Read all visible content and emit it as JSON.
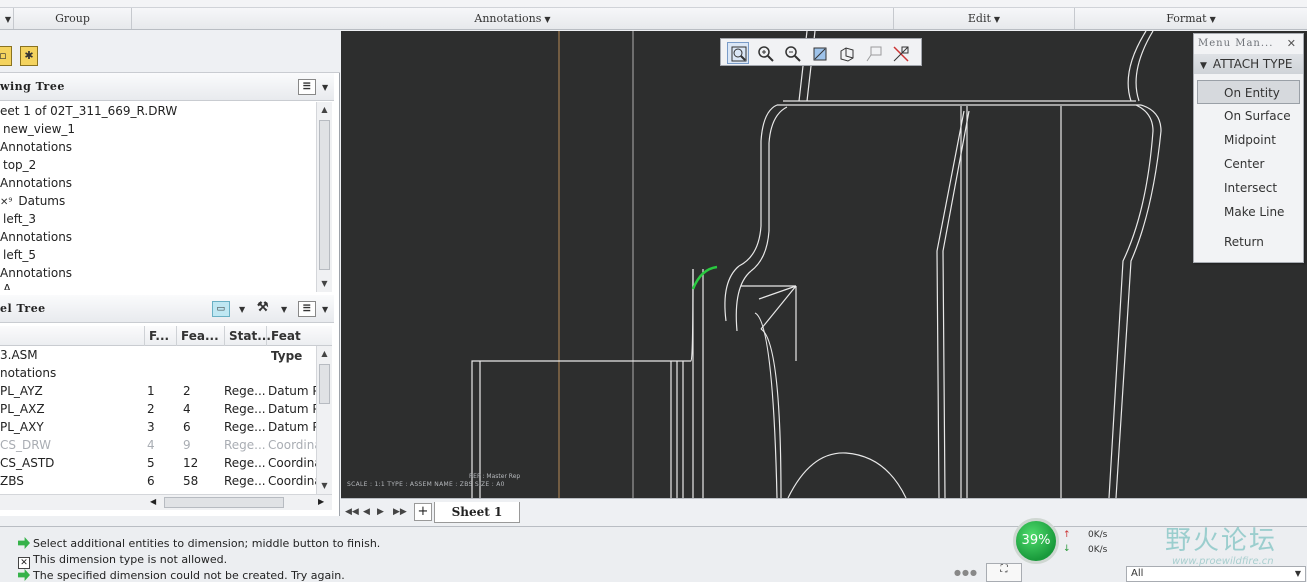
{
  "group_bar": {
    "group": "Group",
    "annotations": "Annotations",
    "edit": "Edit",
    "format": "Format"
  },
  "drawing_tree": {
    "header": "wing Tree",
    "items": [
      "eet 1 of 02T_311_669_R.DRW",
      "new_view_1",
      "Annotations",
      "top_2",
      "Annotations",
      "Datums",
      "left_3",
      "Annotations",
      "left_5",
      "Annotations",
      "A"
    ]
  },
  "model_tree": {
    "header": "el Tree",
    "columns": [
      "F...",
      "Fea...",
      "Stat...",
      "Feat Type"
    ],
    "rows": [
      {
        "name": "3.ASM",
        "f": "",
        "fea": "",
        "stat": "",
        "type": "",
        "dim": false
      },
      {
        "name": "notations",
        "f": "",
        "fea": "",
        "stat": "",
        "type": "",
        "dim": false
      },
      {
        "name": "PL_AYZ",
        "f": "1",
        "fea": "2",
        "stat": "Rege...",
        "type": "Datum P",
        "dim": false
      },
      {
        "name": "PL_AXZ",
        "f": "2",
        "fea": "4",
        "stat": "Rege...",
        "type": "Datum P",
        "dim": false
      },
      {
        "name": "PL_AXY",
        "f": "3",
        "fea": "6",
        "stat": "Rege...",
        "type": "Datum P",
        "dim": false
      },
      {
        "name": "CS_DRW",
        "f": "4",
        "fea": "9",
        "stat": "Rege...",
        "type": "Coordina",
        "dim": true
      },
      {
        "name": "CS_ASTD",
        "f": "5",
        "fea": "12",
        "stat": "Rege...",
        "type": "Coordina",
        "dim": false
      },
      {
        "name": "ZBS",
        "f": "6",
        "fea": "58",
        "stat": "Rege...",
        "type": "Coordina",
        "dim": false
      }
    ]
  },
  "menu_manager": {
    "title": "Menu Man...",
    "section": "ATTACH TYPE",
    "items": [
      "On Entity",
      "On Surface",
      "Midpoint",
      "Center",
      "Intersect",
      "Make Line"
    ],
    "return_label": "Return",
    "selected": "On Entity"
  },
  "graphics": {
    "scale_text": "SCALE : 1:1      TYPE : ASSEM      NAME : ZBS      SIZE : A0",
    "rep_text": "REP : Master Rep",
    "background": "#2d2e2e",
    "highlight": "#29c940"
  },
  "sheet_bar": {
    "tab": "Sheet 1",
    "plus": "+"
  },
  "status": {
    "messages": [
      "Select additional entities to dimension; middle button to finish.",
      "This dimension type is not allowed.",
      "The specified dimension could not be created. Try again."
    ],
    "gauge": "39%",
    "up_speed": "0K/s",
    "down_speed": "0K/s",
    "filter": "All"
  },
  "watermark": {
    "text": "野火论坛",
    "url": "www.proewildfire.cn"
  }
}
